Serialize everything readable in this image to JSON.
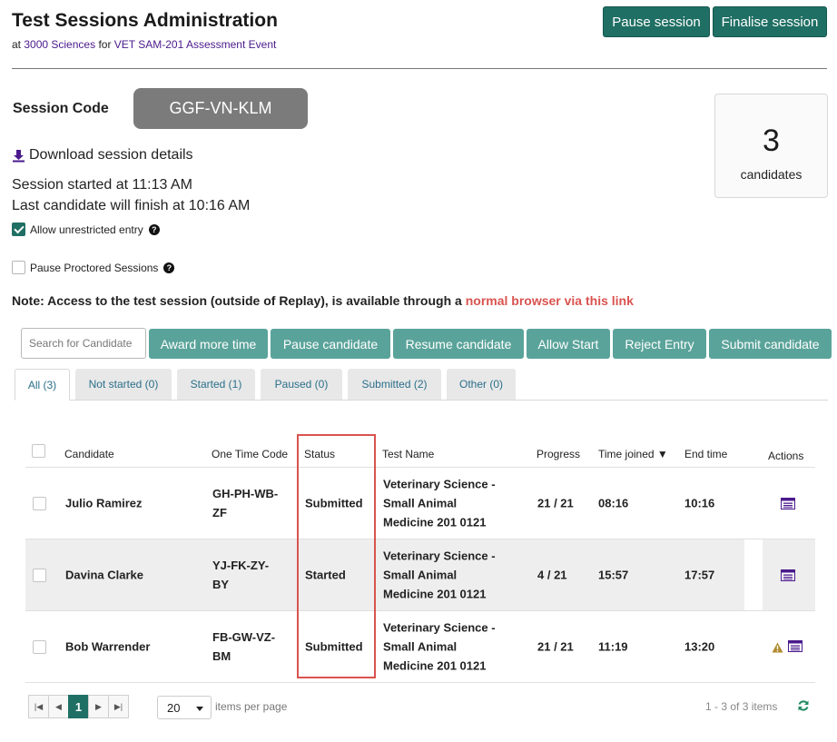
{
  "header": {
    "title": "Test Sessions Administration",
    "subtitle_at": "at",
    "subtitle_org": "3000 Sciences",
    "subtitle_for": "for",
    "subtitle_event": "VET SAM-201 Assessment Event",
    "pause_session": "Pause session",
    "finalise_session": "Finalise session"
  },
  "session": {
    "code_label": "Session Code",
    "code": "GGF-VN-KLM",
    "candidates_count": "3",
    "candidates_label": "candidates",
    "download_label": "Download session details",
    "started_text": "Session started at 11:13 AM",
    "finish_text": "Last candidate will finish at 10:16 AM",
    "allow_unrestricted": {
      "label": "Allow unrestricted entry",
      "checked": true
    },
    "pause_proctored": {
      "label": "Pause Proctored Sessions",
      "checked": false
    },
    "note_text": "Note: Access to the test session (outside of Replay), is available through a",
    "note_link": "normal browser via this link"
  },
  "toolbar": {
    "search_placeholder": "Search for Candidate",
    "award_more_time": "Award more time",
    "pause_candidate": "Pause candidate",
    "resume_candidate": "Resume candidate",
    "allow_start": "Allow Start",
    "reject_entry": "Reject Entry",
    "submit_candidate": "Submit candidate"
  },
  "tabs": [
    {
      "label": "All (3)",
      "active": true
    },
    {
      "label": "Not started (0)",
      "active": false
    },
    {
      "label": "Started (1)",
      "active": false
    },
    {
      "label": "Paused (0)",
      "active": false
    },
    {
      "label": "Submitted (2)",
      "active": false
    },
    {
      "label": "Other (0)",
      "active": false
    }
  ],
  "table": {
    "columns": {
      "candidate": "Candidate",
      "one_time_code": "One Time Code",
      "status": "Status",
      "test_name": "Test Name",
      "progress": "Progress",
      "time_joined": "Time joined ▼",
      "end_time": "End time",
      "actions": "Actions"
    },
    "rows": [
      {
        "candidate": "Julio Ramirez",
        "otc_line1": "GH-PH-WB-",
        "otc_line2": "ZF",
        "status": "Submitted",
        "test_line1": "Veterinary Science -",
        "test_line2": "Small Animal",
        "test_line3": "Medicine 201 0121",
        "progress": "21 / 21",
        "time_joined": "08:16",
        "end_time": "10:16",
        "warning": false
      },
      {
        "candidate": "Davina Clarke",
        "otc_line1": "YJ-FK-ZY-",
        "otc_line2": "BY",
        "status": "Started",
        "test_line1": "Veterinary Science -",
        "test_line2": "Small Animal",
        "test_line3": "Medicine 201 0121",
        "progress": "4 / 21",
        "time_joined": "15:57",
        "end_time": "17:57",
        "warning": false
      },
      {
        "candidate": "Bob Warrender",
        "otc_line1": "FB-GW-VZ-",
        "otc_line2": "BM",
        "status": "Submitted",
        "test_line1": "Veterinary Science -",
        "test_line2": "Small Animal",
        "test_line3": "Medicine 201 0121",
        "progress": "21 / 21",
        "time_joined": "11:19",
        "end_time": "13:20",
        "warning": true
      }
    ]
  },
  "pager": {
    "current_page": "1",
    "per_page": "20",
    "items_per_page_label": "items per page",
    "count_text": "1 - 3 of 3 items"
  },
  "colors": {
    "primary": "#1f6f64",
    "action_button": "#5aa39a",
    "link_red": "#d9534f",
    "link_purple": "#4a1a8c",
    "session_code_bg": "#7b7b7b"
  }
}
